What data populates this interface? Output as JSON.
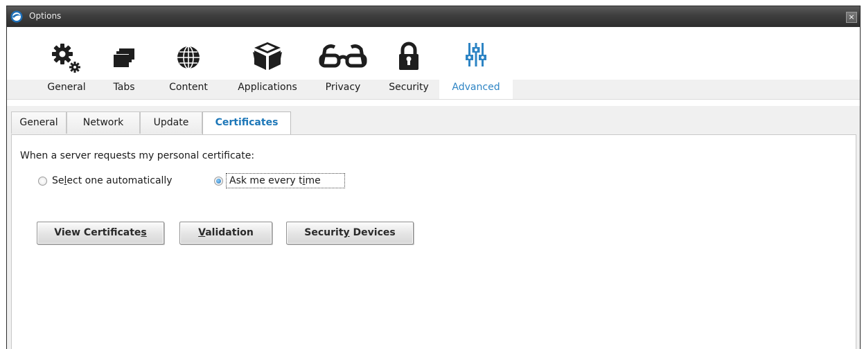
{
  "window": {
    "title": "Options",
    "close_glyph": "×"
  },
  "toolbar": {
    "items": [
      {
        "label": "General",
        "icon": "gear-icon"
      },
      {
        "label": "Tabs",
        "icon": "tabs-icon"
      },
      {
        "label": "Content",
        "icon": "globe-icon"
      },
      {
        "label": "Applications",
        "icon": "box-icon"
      },
      {
        "label": "Privacy",
        "icon": "glasses-icon"
      },
      {
        "label": "Security",
        "icon": "lock-icon"
      },
      {
        "label": "Advanced",
        "icon": "sliders-icon"
      }
    ],
    "active": "Advanced",
    "active_color": "#2d84c4"
  },
  "subtabs": {
    "items": [
      "General",
      "Network",
      "Update",
      "Certificates"
    ],
    "active": "Certificates"
  },
  "certificates": {
    "question": "When a server requests my personal certificate:",
    "option_auto_pre": "Se",
    "option_auto_key": "l",
    "option_auto_post": "ect one automatically",
    "option_ask_pre": "Ask me every t",
    "option_ask_key": "i",
    "option_ask_post": "me",
    "selected_option": "Ask me every time",
    "view_pre": "View Certificate",
    "view_key": "s",
    "view_post": "",
    "validation_pre": "",
    "validation_key": "V",
    "validation_post": "alidation",
    "devices_pre": "Securit",
    "devices_key": "y",
    "devices_post": " Devices"
  }
}
